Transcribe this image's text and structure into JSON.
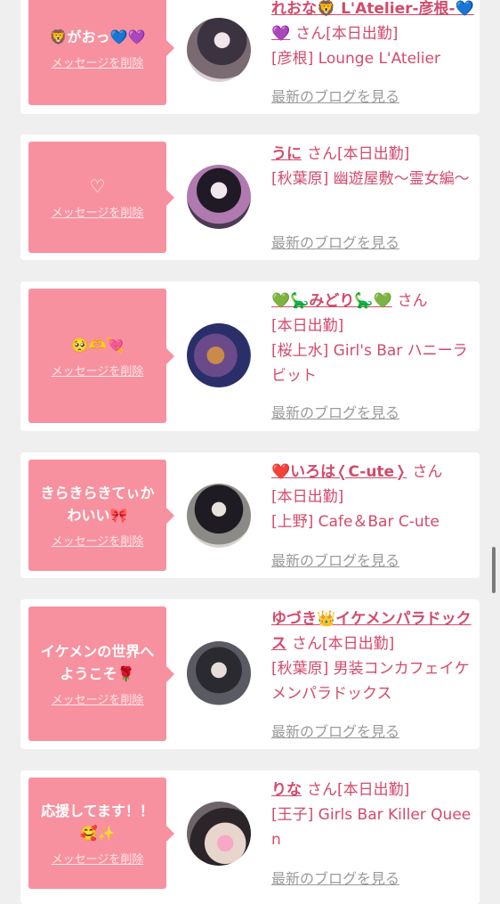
{
  "delete_label": "メッセージを削除",
  "blog_label": "最新のブログを見る",
  "san": "さん",
  "colors": {
    "bubble": "#f7919f",
    "accent": "#d34a6c",
    "link": "#9a9a9a"
  },
  "cards": [
    {
      "message": "🦁がおっ💙💜",
      "name": "れおな🦁 L'Atelier-彦根-💙💜",
      "status": "[本日出勤]",
      "shop": "[彦根] Lounge L'Atelier"
    },
    {
      "message": "♡",
      "name": "うに",
      "status": "[本日出勤]",
      "shop": "[秋葉原] 幽遊屋敷〜霊女編〜"
    },
    {
      "message": "🥺🫶💘",
      "name": "💚🦕みどり🦕💚",
      "status": "[本日出勤]",
      "shop": "[桜上水] Girl's Bar ハニーラビット"
    },
    {
      "message": "きらきらきてぃかわいい🎀",
      "name": "❤️いろは❬C-ute❭",
      "status": "[本日出勤]",
      "shop": "[上野] Cafe＆Bar C-ute"
    },
    {
      "message": "イケメンの世界へようこそ🌹",
      "name": "ゆづき👑イケメンパラドックス",
      "status": "[本日出勤]",
      "shop": "[秋葉原] 男装コンカフェイケメンパラドックス"
    },
    {
      "message": "応援してます！！🥰✨",
      "name": "りな",
      "status": "[本日出勤]",
      "shop": "[王子] Girls Bar Killer Queen"
    }
  ]
}
